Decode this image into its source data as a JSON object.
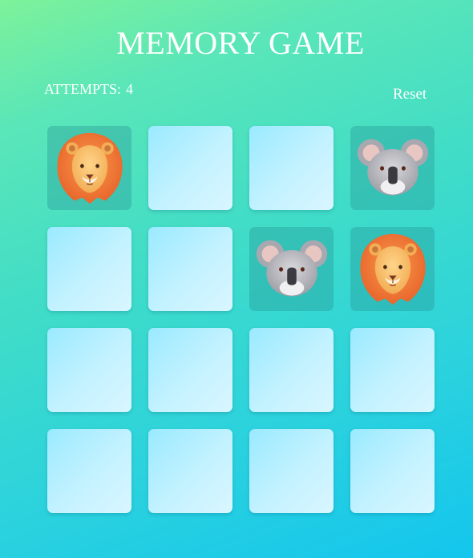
{
  "title": "MEMORY GAME",
  "attempts_label": "ATTEMPTS:",
  "attempts_value": "4",
  "reset_label": "Reset",
  "cards": [
    {
      "state": "revealed",
      "animal": "lion"
    },
    {
      "state": "hidden",
      "animal": ""
    },
    {
      "state": "hidden",
      "animal": ""
    },
    {
      "state": "revealed",
      "animal": "koala"
    },
    {
      "state": "hidden",
      "animal": ""
    },
    {
      "state": "hidden",
      "animal": ""
    },
    {
      "state": "revealed",
      "animal": "koala"
    },
    {
      "state": "revealed",
      "animal": "lion"
    },
    {
      "state": "hidden",
      "animal": ""
    },
    {
      "state": "hidden",
      "animal": ""
    },
    {
      "state": "hidden",
      "animal": ""
    },
    {
      "state": "hidden",
      "animal": ""
    },
    {
      "state": "hidden",
      "animal": ""
    },
    {
      "state": "hidden",
      "animal": ""
    },
    {
      "state": "hidden",
      "animal": ""
    },
    {
      "state": "hidden",
      "animal": ""
    }
  ],
  "colors": {
    "card_back_light": "#d9f6ff",
    "card_back_dark": "#9aeaff",
    "revealed_bg": "#2d9a9a"
  }
}
